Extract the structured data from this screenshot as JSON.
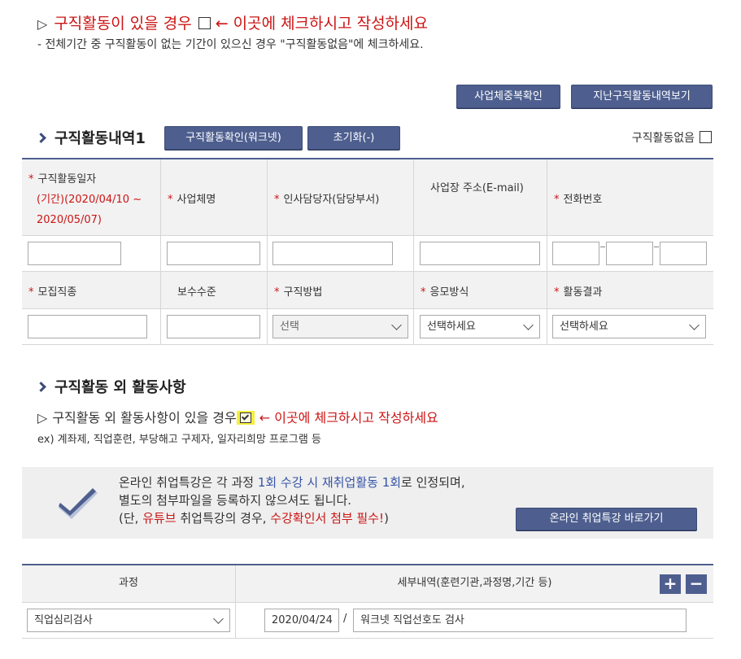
{
  "notice": {
    "marker": "▷",
    "text_before_box": "구직활동이 있을 경우",
    "text_after_box": "← 이곳에 체크하시고 작성하세요",
    "sub": "- 전체기간 중 구직활동이 없는 기간이 있으신 경우 \"구직활동없음\"에 체크하세요."
  },
  "top_buttons": {
    "duplicate_check": "사업체중복확인",
    "past_history": "지난구직활동내역보기"
  },
  "activity_section": {
    "title": "구직활동내역1",
    "worknet_button": "구직활동확인(워크넷)",
    "reset_button": "초기화(-)",
    "no_activity_label": "구직활동없음",
    "row1_headers": {
      "date_label": "구직활동일자",
      "date_range": "(기간)(2020/04/10 ~ 2020/05/07)",
      "company": "사업체명",
      "manager": "인사담당자(담당부서)",
      "address": "사업장 주소(E-mail)",
      "phone": "전화번호"
    },
    "row2_headers": {
      "job_type": "모집직종",
      "salary": "보수수준",
      "method": "구직방법",
      "apply": "응모방식",
      "result": "활동결과"
    },
    "method_select": "선택",
    "apply_select": "선택하세요",
    "result_select": "선택하세요",
    "phone_dash": "-"
  },
  "other_section": {
    "title": "구직활동 외 활동사항",
    "marker": "▷",
    "line_before": "구직활동 외 활동사항이 있을 경우",
    "line_after": "← 이곳에 체크하시고 작성하세요",
    "examples": "ex) 계좌제, 직업훈련, 부당해고 구제자, 일자리희망 프로그램 등"
  },
  "info": {
    "l1_a": "온라인 취업특강은 각 과정 ",
    "l1_b": "1회 수강 시 재취업활동 1회",
    "l1_c": "로 인정되며,",
    "l2": "별도의 첨부파일을 등록하지 않으셔도 됩니다.",
    "l3_a": "(단, ",
    "l3_b": "유튜브",
    "l3_c": " 취업특강의 경우, ",
    "l3_d": "수강확인서 첨부 필수!",
    "l3_e": ")",
    "button": "온라인 취업특강 바로가기"
  },
  "course_table": {
    "col1": "과정",
    "col2": "세부내역(훈련기관,과정명,기간 등)",
    "add": "+",
    "remove": "−",
    "course_select": "직업심리검사",
    "date_value": "2020/04/24",
    "slash": "/",
    "detail_value": "워크넷 직업선호도 검사"
  },
  "colors": {
    "accent": "#4e5f8f",
    "required": "#cc1414",
    "highlight": "#f6ef3a"
  }
}
